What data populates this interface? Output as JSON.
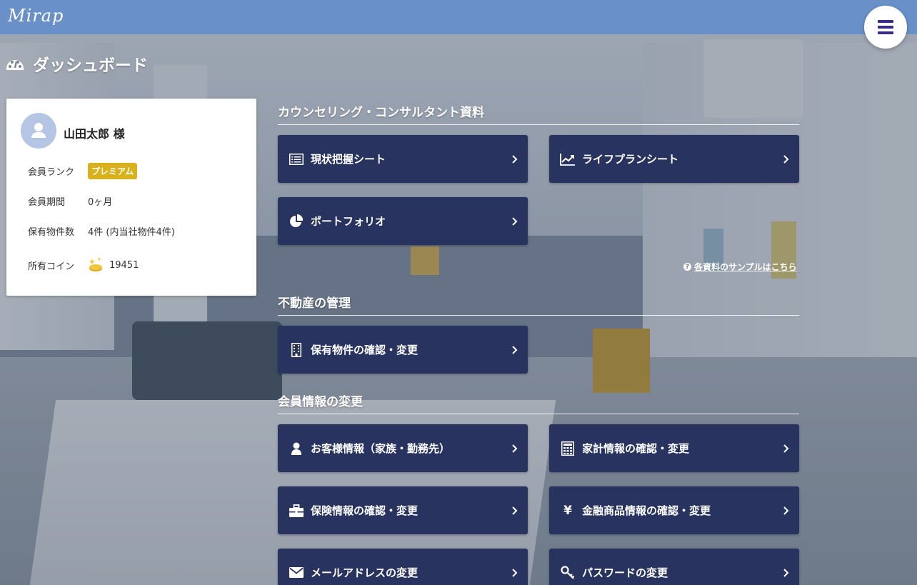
{
  "header": {
    "logo": "Mirap"
  },
  "page": {
    "title": "ダッシュボード"
  },
  "profile": {
    "name": "山田太郎 様",
    "rank_label": "会員ランク",
    "rank_value": "プレミアム",
    "period_label": "会員期間",
    "period_value": "0ヶ月",
    "properties_label": "保有物件数",
    "properties_value": "4件 (内当社物件4件)",
    "coins_label": "所有コイン",
    "coins_value": "19451"
  },
  "sections": {
    "counseling": {
      "title": "カウンセリング・コンサルタント資料",
      "tiles": [
        {
          "label": "現状把握シート",
          "icon": "list-icon"
        },
        {
          "label": "ライフプランシート",
          "icon": "line-chart-icon"
        },
        {
          "label": "ポートフォリオ",
          "icon": "pie-chart-icon"
        }
      ],
      "sample_link": "各資料のサンプルはこちら"
    },
    "realestate": {
      "title": "不動産の管理",
      "tiles": [
        {
          "label": "保有物件の確認・変更",
          "icon": "building-icon"
        }
      ]
    },
    "member": {
      "title": "会員情報の変更",
      "tiles": [
        {
          "label": "お客様情報（家族・勤務先）",
          "icon": "user-icon"
        },
        {
          "label": "家計情報の確認・変更",
          "icon": "calculator-icon"
        },
        {
          "label": "保険情報の確認・変更",
          "icon": "briefcase-icon"
        },
        {
          "label": "金融商品情報の確認・変更",
          "icon": "yen-icon"
        },
        {
          "label": "メールアドレスの変更",
          "icon": "envelope-icon"
        },
        {
          "label": "パスワードの変更",
          "icon": "key-icon"
        }
      ]
    }
  },
  "colors": {
    "topbar": "#6990c9",
    "tile": "#283360",
    "badge": "#d9b11a",
    "menu_icon": "#3a2a8a"
  }
}
